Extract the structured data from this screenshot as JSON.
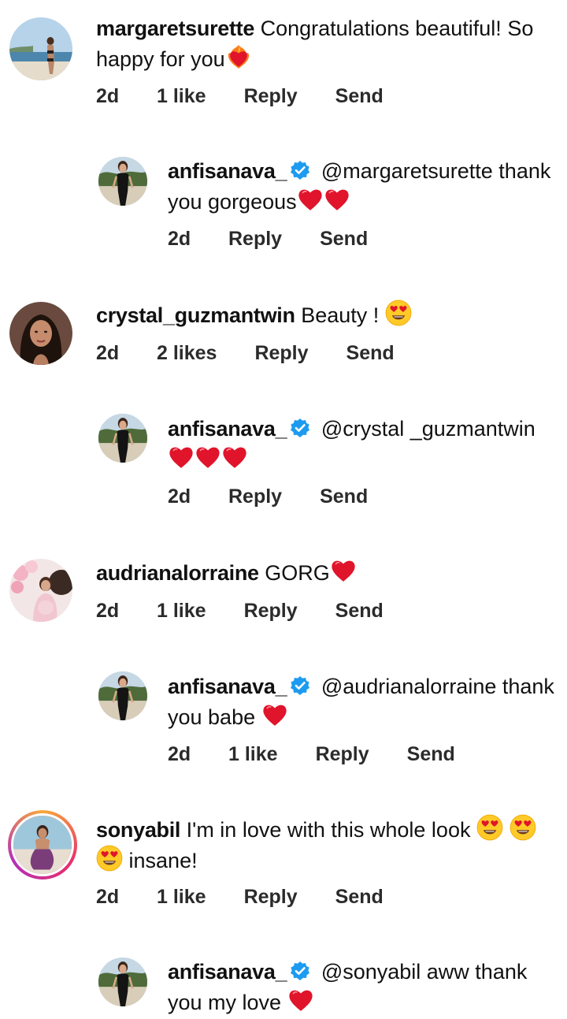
{
  "colors": {
    "background": "#ffffff",
    "text": "#111111",
    "verified": "#1d9bf0",
    "heart": "#e0142b",
    "story_ring": [
      "#f7a93b",
      "#e9306a",
      "#b32fb8"
    ]
  },
  "comments": [
    {
      "username": "margaretsurette",
      "text_before": "Congratulations beautiful! So happy for you",
      "emoji_after": "heart-on-fire",
      "time": "2d",
      "likes": "1 like",
      "reply_label": "Reply",
      "send_label": "Send",
      "avatar_icon": "beach-photo-avatar"
    },
    {
      "username": "anfisanava_",
      "verified": true,
      "text_before": "@margaretsurette thank you gorgeous",
      "emoji_after": "red-heart x2",
      "time": "2d",
      "reply_label": "Reply",
      "send_label": "Send",
      "avatar_icon": "profile-photo-avatar"
    },
    {
      "username": "crystal_guzmantwin",
      "text_before": "Beauty !",
      "emoji_after": "heart-eyes",
      "time": "2d",
      "likes": "2 likes",
      "reply_label": "Reply",
      "send_label": "Send",
      "avatar_icon": "portrait-avatar"
    },
    {
      "username": "anfisanava_",
      "verified": true,
      "text_before": "@crystal _guzmantwin",
      "emoji_after": "red-heart x3",
      "time": "2d",
      "reply_label": "Reply",
      "send_label": "Send",
      "avatar_icon": "profile-photo-avatar"
    },
    {
      "username": "audrianalorraine",
      "text_before": "GORG",
      "emoji_after": "red-heart",
      "time": "2d",
      "likes": "1 like",
      "reply_label": "Reply",
      "send_label": "Send",
      "avatar_icon": "pink-balloons-avatar"
    },
    {
      "username": "anfisanava_",
      "verified": true,
      "text_before": "@audrianalorraine thank you babe",
      "emoji_after": "red-heart",
      "time": "2d",
      "likes": "1 like",
      "reply_label": "Reply",
      "send_label": "Send",
      "avatar_icon": "profile-photo-avatar"
    },
    {
      "username": "sonyabil",
      "story_ring": true,
      "text_before": "I'm in love with this whole look",
      "emoji_mid": "heart-eyes x3",
      "text_after": "insane!",
      "time": "2d",
      "likes": "1 like",
      "reply_label": "Reply",
      "send_label": "Send",
      "avatar_icon": "fitness-photo-avatar"
    },
    {
      "username": "anfisanava_",
      "verified": true,
      "text_before": "@sonyabil aww thank you my love",
      "emoji_after": "red-heart",
      "avatar_icon": "profile-photo-avatar"
    }
  ]
}
